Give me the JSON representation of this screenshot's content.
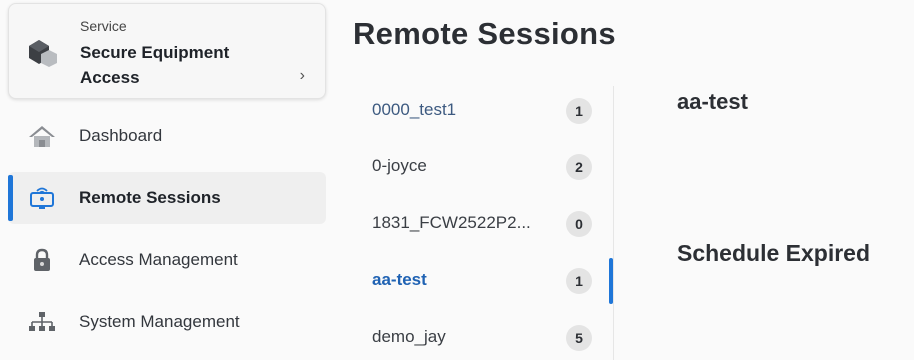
{
  "service": {
    "kicker": "Service",
    "name": "Secure Equipment Access",
    "chevron": "›"
  },
  "nav": {
    "items": [
      {
        "label": "Dashboard",
        "icon": "home-icon",
        "active": false
      },
      {
        "label": "Remote Sessions",
        "icon": "remote-monitor-icon",
        "active": true
      },
      {
        "label": "Access Management",
        "icon": "lock-icon",
        "active": false
      },
      {
        "label": "System Management",
        "icon": "hierarchy-icon",
        "active": false
      }
    ]
  },
  "page": {
    "title": "Remote Sessions"
  },
  "sessions": [
    {
      "name": "0000_test1",
      "count": "1",
      "active": false
    },
    {
      "name": "0-joyce",
      "count": "2",
      "active": false
    },
    {
      "name": "1831_FCW2522P2...",
      "count": "0",
      "active": false
    },
    {
      "name": "aa-test",
      "count": "1",
      "active": true
    },
    {
      "name": "demo_jay",
      "count": "5",
      "active": false
    }
  ],
  "detail": {
    "title": "aa-test",
    "status": "Schedule Expired"
  },
  "colors": {
    "accent": "#1f76d8",
    "active_text": "#1f62b3"
  }
}
